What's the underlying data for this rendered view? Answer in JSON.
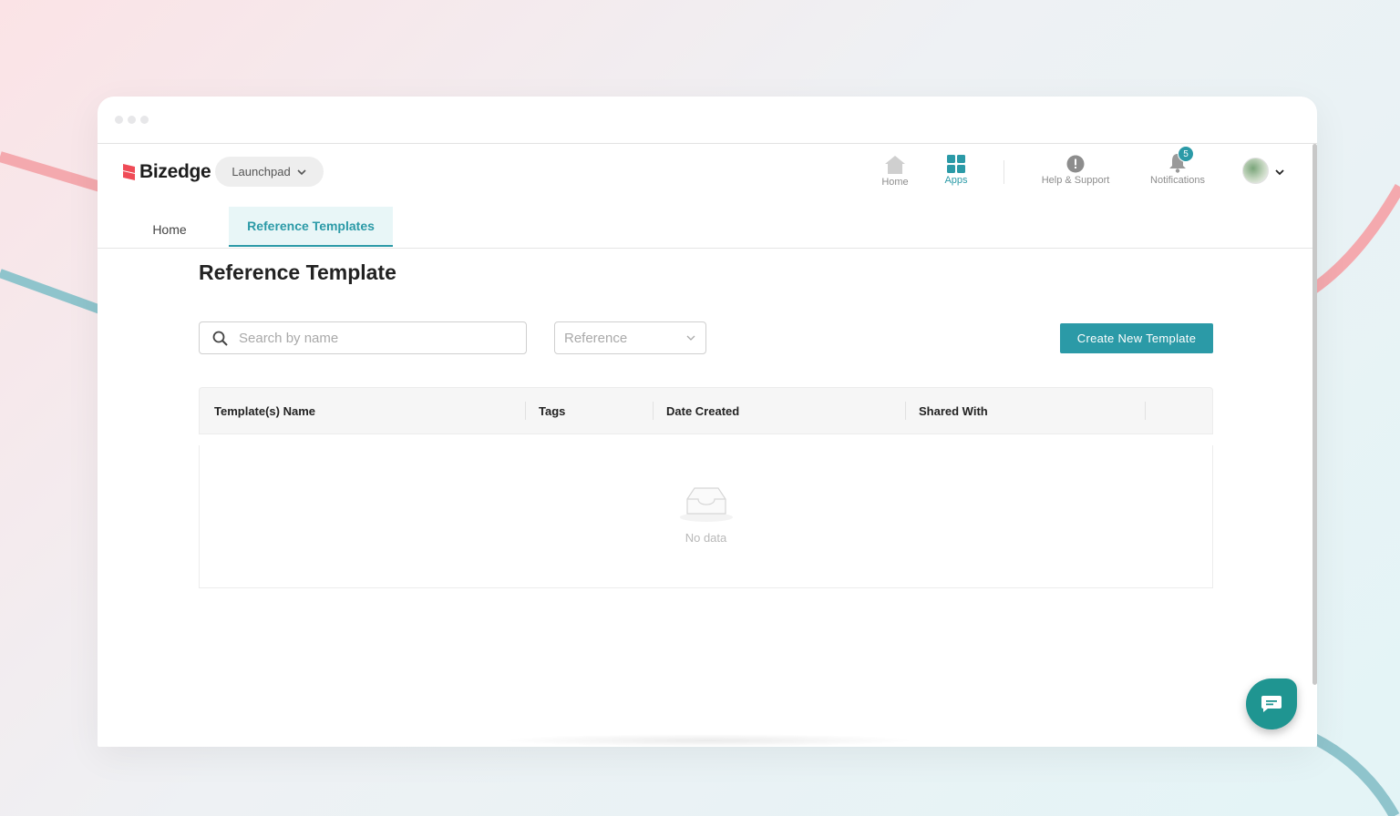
{
  "brand": {
    "name": "Bizedge",
    "logo_color": "#ef4b57"
  },
  "launchpad": {
    "label": "Launchpad"
  },
  "topnav": {
    "home_label": "Home",
    "apps_label": "Apps",
    "help_label": "Help & Support",
    "notifications_label": "Notifications",
    "notifications_count": "5",
    "accent_color": "#2b9aa7"
  },
  "tabs": [
    {
      "label": "Home",
      "active": false
    },
    {
      "label": "Reference Templates",
      "active": true
    }
  ],
  "page": {
    "title": "Reference Template"
  },
  "search": {
    "placeholder": "Search by name",
    "value": ""
  },
  "filter": {
    "selected": "Reference"
  },
  "create_button": {
    "label": "Create New Template"
  },
  "table": {
    "columns": [
      "Template(s) Name",
      "Tags",
      "Date Created",
      "Shared With"
    ],
    "rows": [],
    "empty_text": "No data"
  },
  "icons": {
    "home": "home-icon",
    "apps": "apps-grid-icon",
    "help": "help-icon",
    "notifications": "bell-icon",
    "search": "search-icon",
    "empty": "empty-inbox-icon",
    "chat": "chat-icon"
  }
}
